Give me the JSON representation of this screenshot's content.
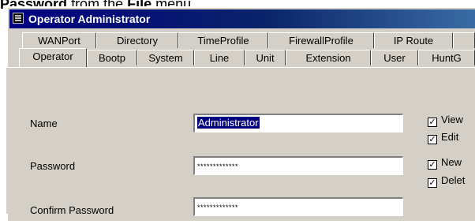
{
  "doc": {
    "word1": "Password",
    "rest": "from the",
    "word2": "File",
    "end": "menu."
  },
  "window": {
    "title": "Operator Administrator",
    "icon": "system-menu-icon"
  },
  "tabs_row1": [
    "WANPort",
    "Directory",
    "TimeProfile",
    "FirewallProfile",
    "IP Route"
  ],
  "tabs_row2": [
    "Operator",
    "Bootp",
    "System",
    "Line",
    "Unit",
    "Extension",
    "User",
    "HuntG"
  ],
  "active_tab": "Operator",
  "form": {
    "name_label": "Name",
    "name_value": "Administrator",
    "password_label": "Password",
    "password_value": "*************",
    "confirm_label": "Confirm Password",
    "confirm_value": "*************"
  },
  "permissions": [
    {
      "label": "View",
      "checked": true
    },
    {
      "label": "Edit",
      "checked": true
    },
    {
      "label": "New",
      "checked": true
    },
    {
      "label": "Delet",
      "checked": true
    }
  ],
  "colors": {
    "titlebar": "#000080",
    "face": "#d4d0c8",
    "selection": "#000080"
  }
}
